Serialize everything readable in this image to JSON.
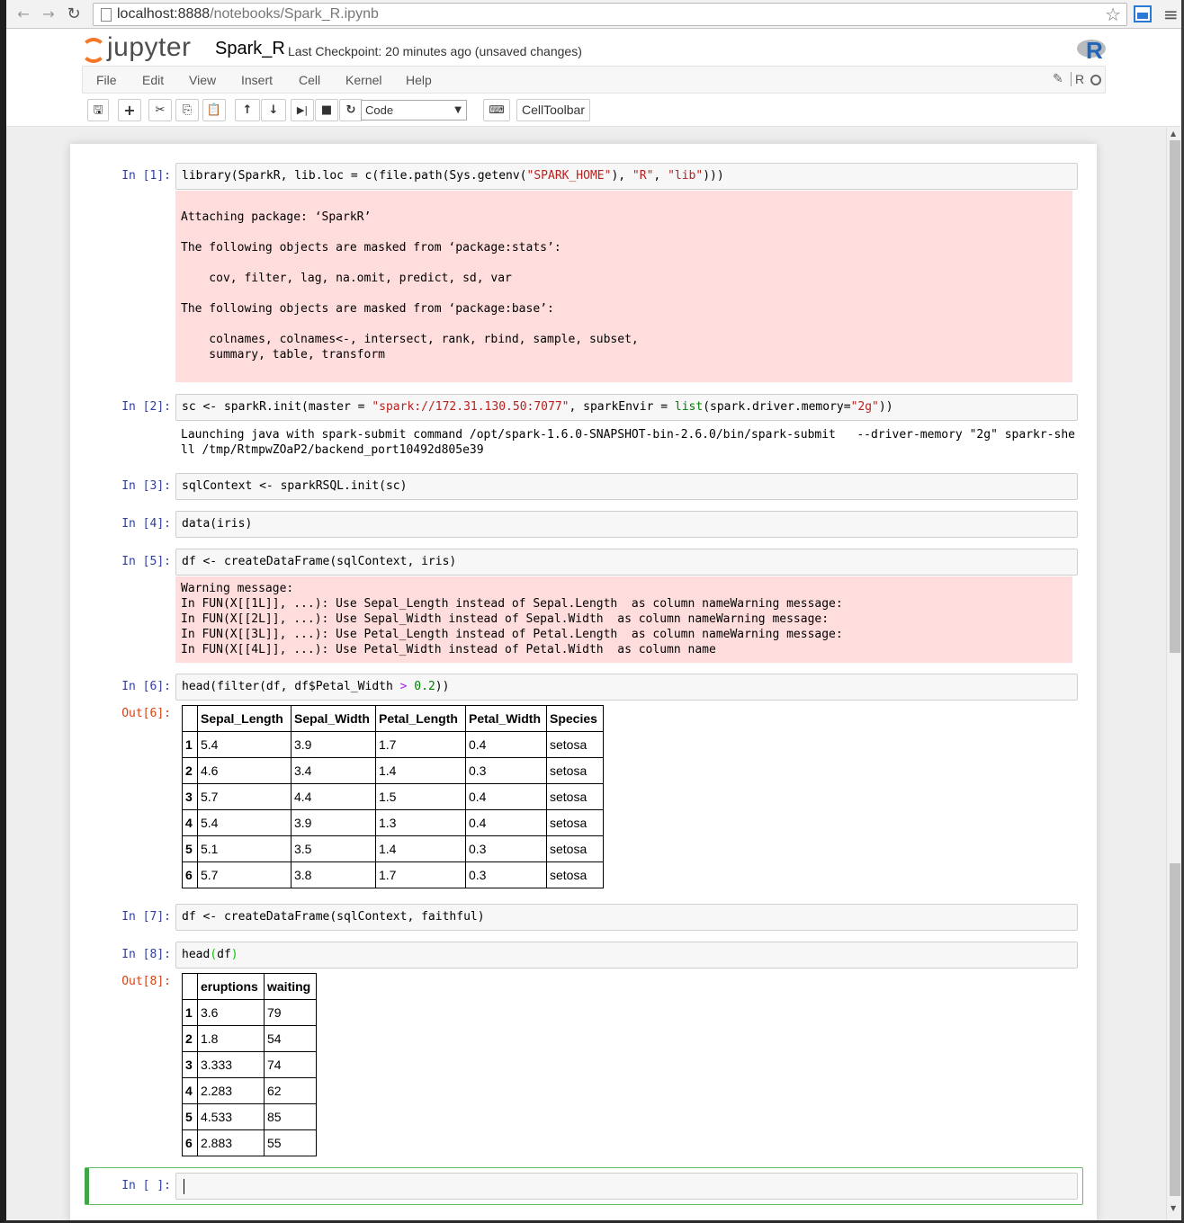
{
  "browser": {
    "url_host": "localhost:8888",
    "url_path": "/notebooks/Spark_R.ipynb"
  },
  "header": {
    "logo_text": "jupyter",
    "notebook_name": "Spark_R",
    "checkpoint": "Last Checkpoint: 20 minutes ago (unsaved changes)",
    "kernel_logo_letter": "R",
    "kernel_name": "R"
  },
  "menu": [
    "File",
    "Edit",
    "View",
    "Insert",
    "Cell",
    "Kernel",
    "Help"
  ],
  "toolbar": {
    "cell_type": "Code",
    "celltoolbar_label": "CellToolbar"
  },
  "cells": {
    "c1": {
      "prompt": "In [1]:",
      "stderr": "Attaching package: ‘SparkR’\n\nThe following objects are masked from ‘package:stats’:\n\n    cov, filter, lag, na.omit, predict, sd, var\n\nThe following objects are masked from ‘package:base’:\n\n    colnames, colnames<-, intersect, rank, rbind, sample, subset,\n    summary, table, transform"
    },
    "c2": {
      "prompt": "In [2]:",
      "stdout": "Launching java with spark-submit command /opt/spark-1.6.0-SNAPSHOT-bin-2.6.0/bin/spark-submit   --driver-memory \"2g\" sparkr-she\nll /tmp/RtmpwZOaP2/backend_port10492d805e39"
    },
    "c3": {
      "prompt": "In [3]:",
      "code": "sqlContext <- sparkRSQL.init(sc)"
    },
    "c4": {
      "prompt": "In [4]:",
      "code": "data(iris)"
    },
    "c5": {
      "prompt": "In [5]:",
      "code": "df <- createDataFrame(sqlContext, iris)",
      "stderr": "Warning message:\nIn FUN(X[[1L]], ...): Use Sepal_Length instead of Sepal.Length  as column nameWarning message:\nIn FUN(X[[2L]], ...): Use Sepal_Width instead of Sepal.Width  as column nameWarning message:\nIn FUN(X[[3L]], ...): Use Petal_Length instead of Petal.Length  as column nameWarning message:\nIn FUN(X[[4L]], ...): Use Petal_Width instead of Petal.Width  as column name"
    },
    "c6": {
      "prompt": "In [6]:",
      "out_prompt": "Out[6]:",
      "table": {
        "columns": [
          "",
          "Sepal_Length",
          "Sepal_Width",
          "Petal_Length",
          "Petal_Width",
          "Species"
        ],
        "rows": [
          [
            "1",
            "5.4",
            "3.9",
            "1.7",
            "0.4",
            "setosa"
          ],
          [
            "2",
            "4.6",
            "3.4",
            "1.4",
            "0.3",
            "setosa"
          ],
          [
            "3",
            "5.7",
            "4.4",
            "1.5",
            "0.4",
            "setosa"
          ],
          [
            "4",
            "5.4",
            "3.9",
            "1.3",
            "0.4",
            "setosa"
          ],
          [
            "5",
            "5.1",
            "3.5",
            "1.4",
            "0.3",
            "setosa"
          ],
          [
            "6",
            "5.7",
            "3.8",
            "1.7",
            "0.3",
            "setosa"
          ]
        ]
      }
    },
    "c7": {
      "prompt": "In [7]:",
      "code": "df <- createDataFrame(sqlContext, faithful)"
    },
    "c8": {
      "prompt": "In [8]:",
      "out_prompt": "Out[8]:",
      "table": {
        "columns": [
          "",
          "eruptions",
          "waiting"
        ],
        "rows": [
          [
            "1",
            "3.6",
            "79"
          ],
          [
            "2",
            "1.8",
            "54"
          ],
          [
            "3",
            "3.333",
            "74"
          ],
          [
            "4",
            "2.283",
            "62"
          ],
          [
            "5",
            "4.533",
            "85"
          ],
          [
            "6",
            "2.883",
            "55"
          ]
        ]
      }
    },
    "c9": {
      "prompt": "In [ ]:",
      "code": ""
    }
  },
  "colors": {
    "prompt_in": "#303f9f",
    "prompt_out": "#d84315",
    "stderr_bg": "#ffdddd",
    "string": "#ba2121",
    "selected_border": "#42a547"
  }
}
